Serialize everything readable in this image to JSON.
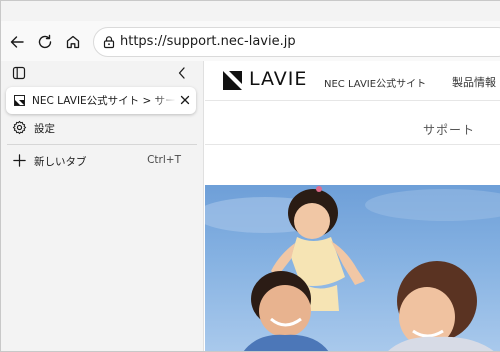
{
  "browser": {
    "address_bar": {
      "url": "https://support.nec-lavie.jp"
    }
  },
  "icons": {
    "back": "back-arrow-icon",
    "refresh": "refresh-icon",
    "home": "home-icon",
    "lock": "lock-icon",
    "panel": "tab-actions-panel-icon",
    "collapse": "chevron-left-icon",
    "close": "close-icon",
    "settings": "gear-icon",
    "new_tab": "plus-icon"
  },
  "sidebar": {
    "active_tab": {
      "title": "NEC LAVIE公式サイト > サービス&サ"
    },
    "items": [
      {
        "label": "設定",
        "shortcut": ""
      },
      {
        "label": "新しいタブ",
        "shortcut": "Ctrl+T"
      }
    ]
  },
  "page": {
    "logo_text": "LAVIE",
    "site_name": "NEC LAVIE公式サイト",
    "nav_products": "製品情報",
    "sub_nav_support": "サポート"
  },
  "colors": {
    "sidebar_bg": "#f3f3f3",
    "toolbar_bg": "#f9f9f9",
    "hero_sky": "#86b2e2",
    "logo": "#111111"
  }
}
